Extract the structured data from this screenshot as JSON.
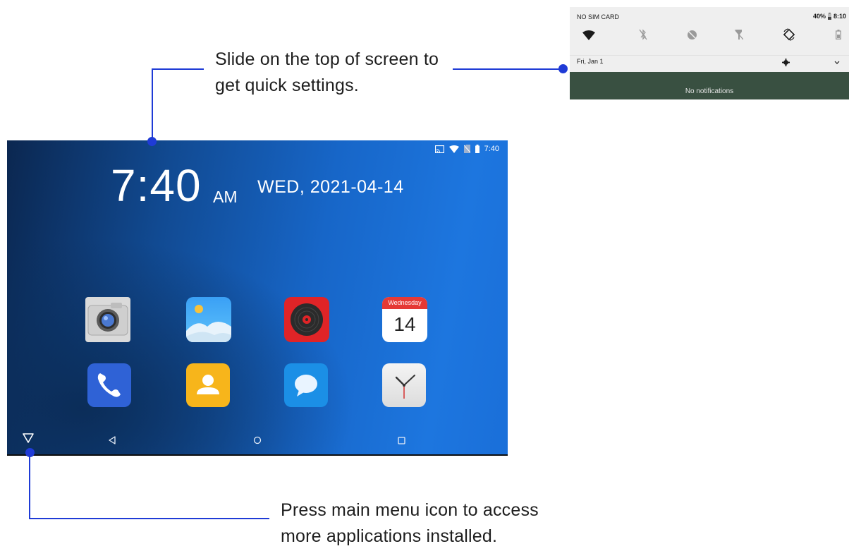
{
  "callouts": {
    "top_line1": "Slide on the top of screen to",
    "top_line2": "get quick settings.",
    "bottom_line1": "Press main menu icon to access",
    "bottom_line2": "more applications installed."
  },
  "tablet": {
    "status_time": "7:40",
    "status_icons": [
      "cast-icon",
      "wifi-icon",
      "no-sim-icon",
      "battery-icon"
    ],
    "clock_time": "7:40",
    "clock_ampm": "AM",
    "clock_date": "WED, 2021-04-14",
    "apps_row1": [
      {
        "name": "camera-app-icon"
      },
      {
        "name": "gallery-app-icon"
      },
      {
        "name": "music-app-icon"
      },
      {
        "name": "calendar-app-icon",
        "weekday": "Wednesday",
        "day": "14"
      }
    ],
    "apps_row2": [
      {
        "name": "phone-app-icon"
      },
      {
        "name": "contacts-app-icon"
      },
      {
        "name": "messages-app-icon"
      },
      {
        "name": "clock-app-icon"
      }
    ],
    "nav_icons": [
      "app-drawer-icon",
      "back-icon",
      "home-icon",
      "recents-icon"
    ]
  },
  "quick_settings": {
    "carrier": "NO SIM CARD",
    "battery": "40%",
    "time": "8:10",
    "date": "Fri, Jan 1",
    "notifications_text": "No notifications",
    "tiles": [
      "wifi-icon",
      "bluetooth-off-icon",
      "dnd-icon",
      "flashlight-off-icon",
      "auto-rotate-icon",
      "battery-saver-icon"
    ]
  },
  "colors": {
    "accent": "#1f3bd6",
    "notification_bg": "#395041"
  }
}
